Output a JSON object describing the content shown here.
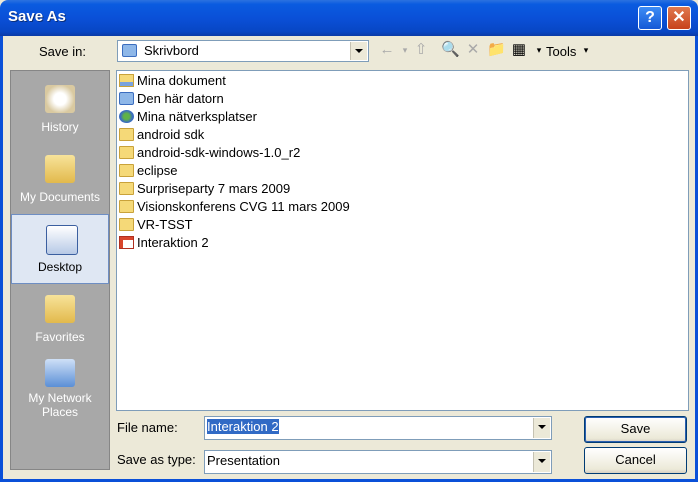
{
  "window": {
    "title": "Save As",
    "help_label": "?",
    "close_label": "✕"
  },
  "save_in": {
    "label": "Save in:",
    "value": "Skrivbord"
  },
  "toolbar": {
    "back_icon": "←",
    "up_icon": "⇧",
    "search_icon": "🔍",
    "delete_icon": "✕",
    "new_folder_icon": "📁",
    "views_icon": "▦",
    "tools_label": "Tools"
  },
  "places": [
    {
      "label": "History",
      "icon": "history-icon",
      "selected": false
    },
    {
      "label": "My Documents",
      "icon": "my-documents-icon",
      "selected": false
    },
    {
      "label": "Desktop",
      "icon": "desktop-icon",
      "selected": true
    },
    {
      "label": "Favorites",
      "icon": "favorites-icon",
      "selected": false
    },
    {
      "label": "My Network Places",
      "icon": "network-places-icon",
      "selected": false
    }
  ],
  "files": [
    {
      "name": "Mina dokument",
      "icon": "my-documents-folder-icon"
    },
    {
      "name": "Den här datorn",
      "icon": "computer-icon"
    },
    {
      "name": "Mina nätverksplatser",
      "icon": "network-icon"
    },
    {
      "name": "android sdk",
      "icon": "folder-icon"
    },
    {
      "name": "android-sdk-windows-1.0_r2",
      "icon": "folder-icon"
    },
    {
      "name": "eclipse",
      "icon": "folder-icon"
    },
    {
      "name": "Surpriseparty 7 mars 2009",
      "icon": "folder-icon"
    },
    {
      "name": "Visionskonferens CVG 11 mars 2009",
      "icon": "folder-icon"
    },
    {
      "name": "VR-TSST",
      "icon": "folder-icon"
    },
    {
      "name": "Interaktion 2",
      "icon": "presentation-file-icon"
    }
  ],
  "file_name": {
    "label": "File name:",
    "value": "Interaktion 2"
  },
  "save_as_type": {
    "label": "Save as type:",
    "value": "Presentation"
  },
  "buttons": {
    "save": "Save",
    "cancel": "Cancel"
  }
}
